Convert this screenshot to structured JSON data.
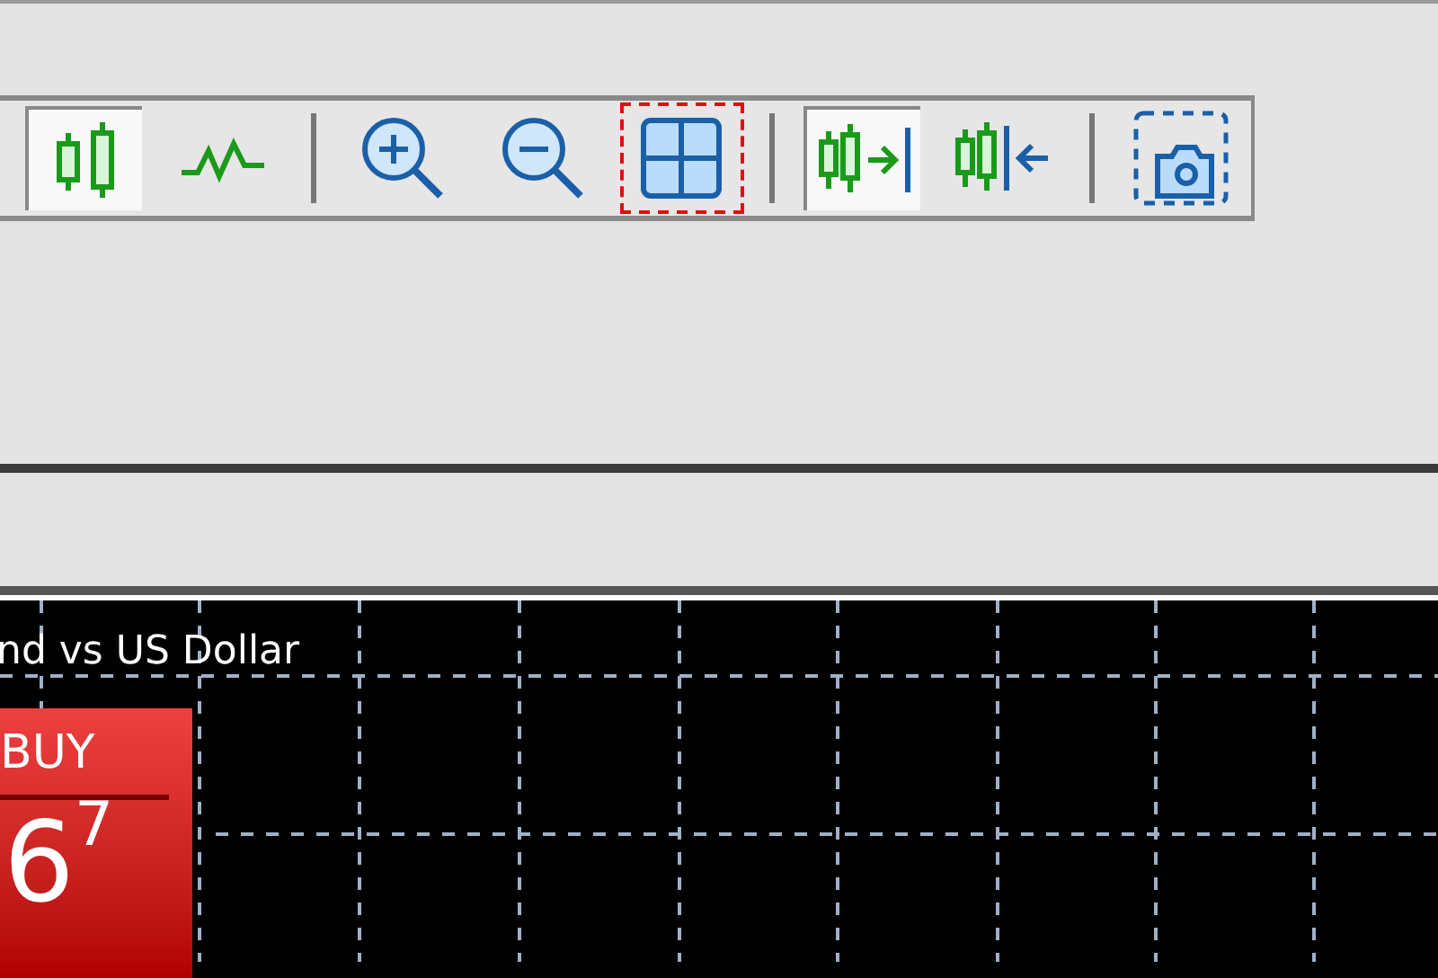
{
  "toolbar": {
    "buttons": [
      {
        "kind": "candles",
        "pressed": true,
        "highlighted": false
      },
      {
        "kind": "line",
        "pressed": false,
        "highlighted": false
      },
      {
        "kind": "separator"
      },
      {
        "kind": "zoom_in",
        "pressed": false,
        "highlighted": false
      },
      {
        "kind": "zoom_out",
        "pressed": false,
        "highlighted": false
      },
      {
        "kind": "tile",
        "pressed": false,
        "highlighted": true
      },
      {
        "kind": "separator"
      },
      {
        "kind": "chart_shift",
        "pressed": true,
        "highlighted": false
      },
      {
        "kind": "auto_scroll",
        "pressed": false,
        "highlighted": false
      },
      {
        "kind": "separator"
      },
      {
        "kind": "screenshot",
        "pressed": false,
        "highlighted": false
      }
    ]
  },
  "chart": {
    "title": "nd vs US Dollar",
    "buy_panel": {
      "label": "BUY",
      "price": "6$^{7}$"
    }
  }
}
